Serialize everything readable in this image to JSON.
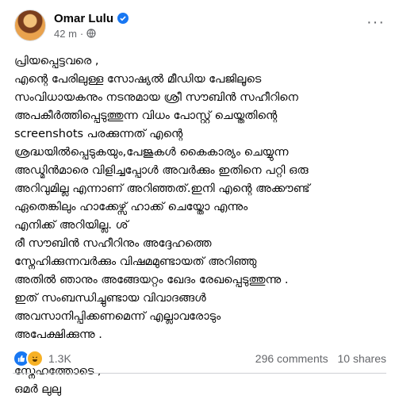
{
  "author": {
    "name": "Omar Lulu",
    "time": "42 m",
    "dot": "·"
  },
  "post": {
    "lines": [
      "പ്രിയപ്പെട്ടവരെ ,",
      "എന്റെ പേരിലുള്ള സോഷ്യൽ മീഡിയ പേജിലൂടെ",
      "സംവിധായകനും നടനുമായ ശ്രീ സൗബിൻ സഹീറിനെ",
      "അപകീർത്തിപ്പെടുത്തുന്ന വിധം പോസ്റ്റ് ചെയ്തതിന്റെ",
      "screenshots പരക്കുന്നത് എന്റെ",
      "ശ്രദ്ധയിൽപ്പെടുകയും,പേജുകൾ കൈകാര്യം ചെയ്യുന്ന",
      "അഡ്മിൻമാരെ വിളിച്ചപ്പോൾ അവർക്കും ഇതിനെ പറ്റി ഒരു",
      "അറിവുമില്ല എന്നാണ് അറിഞ്ഞത്.ഇനി എന്റെ  അക്കൗണ്ട്",
      "ഏതെങ്കിലും ഹാക്കേഴ്സ് ഹാക്ക് ചെയ്തോ എന്നും",
      "എനിക്ക് അറിയില്ല. ശ്",
      "രീ സൗബിൻ സഹീറിനും അദ്ദേഹത്തെ",
      "സ്നേഹിക്കുന്നവർക്കും വിഷമമുണ്ടായത് അറിഞ്ഞു",
      "അതിൽ ഞാനും അങ്ങേയറ്റം ഖേദം രേഖപ്പെടുത്തുന്നു .",
      "ഇത് സംബന്ധിച്ചുണ്ടായ വിവാദങ്ങൾ",
      "അവസാനിപ്പിക്കണമെന്ന് എല്ലാവരോടും",
      "അപേക്ഷിക്കുന്നു ."
    ],
    "closing": [
      "സ്നേഹത്തോടെ ,",
      "ഒമർ ലുലു"
    ]
  },
  "footer": {
    "reaction_count": "1.3K",
    "comments": "296 comments",
    "shares": "10 shares"
  },
  "icons": {
    "verified": "verified-badge-icon",
    "audience": "globe-icon",
    "more": "more-options-icon",
    "reactions": [
      "like-reaction-icon",
      "haha-reaction-icon"
    ]
  },
  "colors": {
    "verified": "#1877f2",
    "meta_text": "#65676b",
    "like": "#1877f2",
    "haha": "#f7b125"
  }
}
